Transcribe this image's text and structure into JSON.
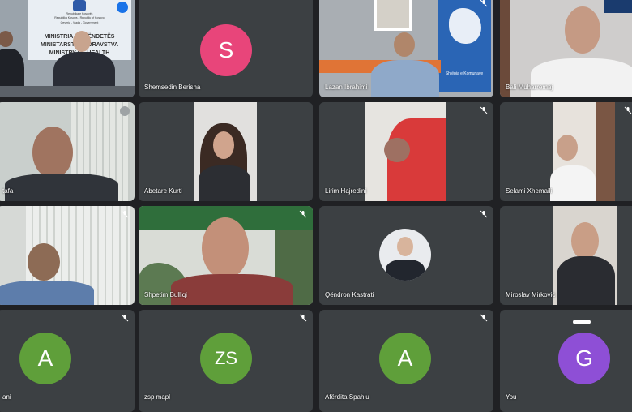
{
  "tiles": [
    {
      "name": "",
      "type": "video"
    },
    {
      "name": "Shemsedin Berisha",
      "type": "avatar",
      "initial": "S",
      "color": "#e8457a"
    },
    {
      "name": "Lazan Ibrahimi",
      "type": "video"
    },
    {
      "name": "Bali Muharremaj",
      "type": "video"
    },
    {
      "name": "tafa",
      "type": "video"
    },
    {
      "name": "Abetare Kurti",
      "type": "video"
    },
    {
      "name": "Lirim Hajredini",
      "type": "video"
    },
    {
      "name": "Selami Xhemaili",
      "type": "video"
    },
    {
      "name": "",
      "type": "video"
    },
    {
      "name": "Shpetim Bulliqi",
      "type": "video"
    },
    {
      "name": "Qëndron Kastrati",
      "type": "photo"
    },
    {
      "name": "Miroslav Mirkovic",
      "type": "video"
    },
    {
      "name": "ani",
      "type": "avatar",
      "initial": "A",
      "color": "#5f9f3a"
    },
    {
      "name": "zsp mapl",
      "type": "avatar",
      "initial": "ZS",
      "color": "#5f9f3a"
    },
    {
      "name": "Afërdita Spahiu",
      "type": "avatar",
      "initial": "A",
      "color": "#5f9f3a"
    },
    {
      "name": "You",
      "type": "avatar",
      "initial": "G",
      "color": "#8e4fd6"
    }
  ],
  "banner": {
    "line1": "Republika e Kosovës",
    "line2": "Republika Kosova - Republic of Kosovo",
    "line3": "Qeveria - Vlada - Government",
    "line4": "MINISTRIA E SHËNDETËS",
    "line5": "MINISTARSTVO ZDRAVSTVA",
    "line6": "MINISTRY OF HEALTH"
  },
  "poster_text": "Shtëpia e Komunave"
}
